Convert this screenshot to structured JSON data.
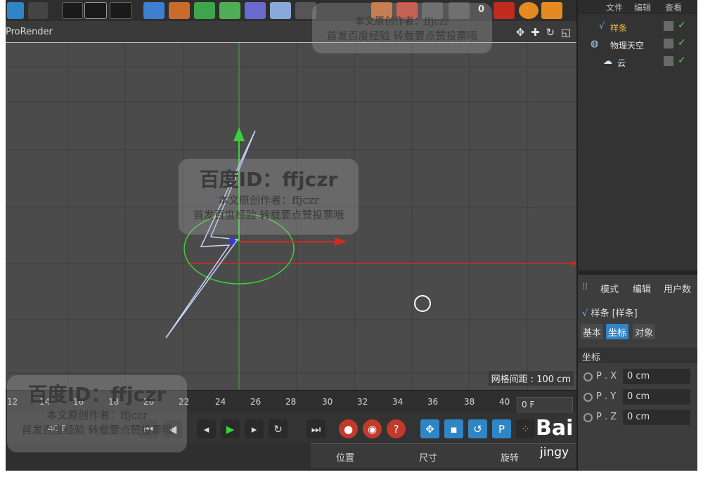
{
  "viewport": {
    "renderer_label": "ProRender",
    "nav_icons": "✥ ✚ ↻ ◱",
    "grid_spacing_label": "网格间距 : 100 cm"
  },
  "timeline": {
    "ticks": [
      "12",
      "14",
      "16",
      "18",
      "20",
      "22",
      "24",
      "26",
      "28",
      "30",
      "32",
      "34",
      "36",
      "38",
      "40"
    ],
    "current_frame": "0 F",
    "end_frame": "40 F"
  },
  "object_manager": {
    "menu": [
      "文件",
      "编辑",
      "查看"
    ],
    "objects": [
      {
        "name": "样条",
        "icon": "spline-icon"
      },
      {
        "name": "物理天空",
        "icon": "physical-sky-icon"
      },
      {
        "name": "云",
        "icon": "cloud-icon"
      }
    ]
  },
  "attribute_manager": {
    "menu": [
      "模式",
      "编辑",
      "用户数"
    ],
    "object_title": "样条 [样条]",
    "tabs": [
      "基本",
      "坐标",
      "对象"
    ],
    "active_tab": "坐标",
    "section": "坐标",
    "rows": [
      {
        "label": "P . X",
        "value": "0 cm"
      },
      {
        "label": "P . Y",
        "value": "0 cm"
      },
      {
        "label": "P . Z",
        "value": "0 cm"
      }
    ]
  },
  "coord_panel": {
    "headers": [
      "位置",
      "尺寸",
      "旋转"
    ]
  },
  "watermark": {
    "title": "百度ID：ffjczr",
    "author": "本文原创作者：ffjczr",
    "note": "首发百度经验  转载要点赞投票哦",
    "logo": "Bai",
    "logo_sub": "jingy"
  },
  "toolbar": {
    "frame_value": "0"
  },
  "colors": {
    "x_axis": "#d42a1e",
    "y_axis": "#3ad13a",
    "spline": "#c8d2ff",
    "active_tab": "#2f86c6",
    "record": "#c23a2b"
  }
}
